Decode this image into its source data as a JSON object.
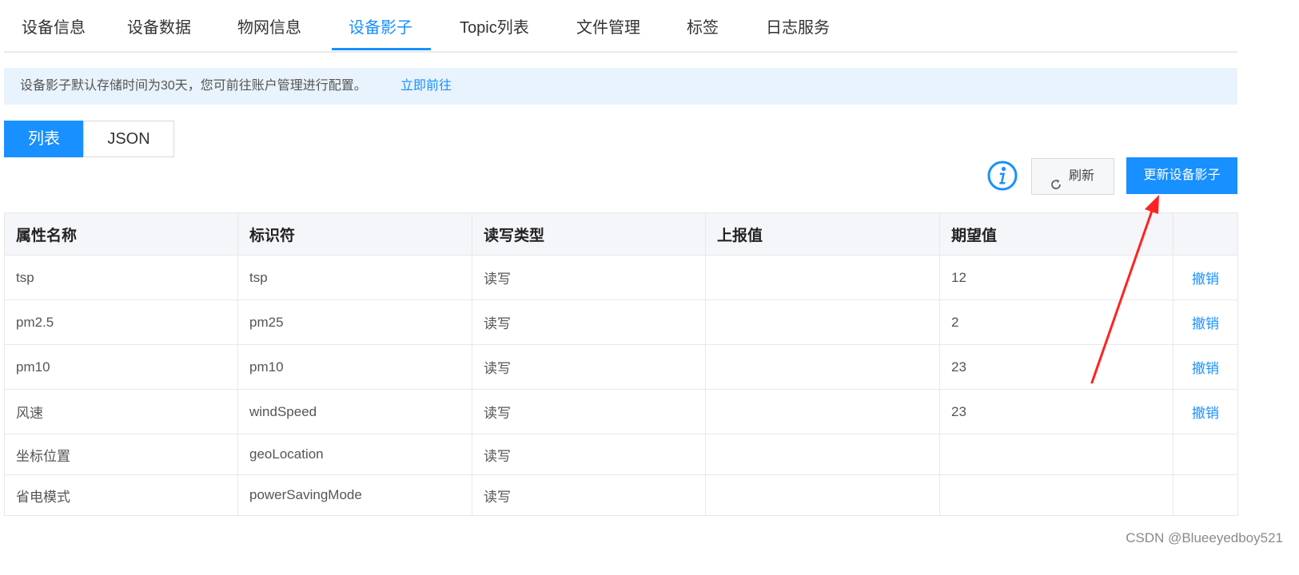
{
  "tabs": [
    {
      "label": "设备信息"
    },
    {
      "label": "设备数据"
    },
    {
      "label": "物网信息"
    },
    {
      "label": "设备影子",
      "active": true
    },
    {
      "label": "Topic列表"
    },
    {
      "label": "文件管理"
    },
    {
      "label": "标签"
    },
    {
      "label": "日志服务"
    }
  ],
  "alert": {
    "text": "设备影子默认存储时间为30天，您可前往账户管理进行配置。",
    "link": "立即前往"
  },
  "view_switch": {
    "list": "列表",
    "json": "JSON",
    "selected": "列表"
  },
  "toolbar": {
    "info_icon": "info-circle-icon",
    "refresh_icon": "refresh-icon",
    "refresh_label": "刷新",
    "update_label": "更新设备影子"
  },
  "table": {
    "columns": [
      "属性名称",
      "标识符",
      "读写类型",
      "上报值",
      "期望值",
      ""
    ],
    "rows": [
      {
        "name": "tsp",
        "identifier": "tsp",
        "rw": "读写",
        "reported": "",
        "desired": "12",
        "action": "撤销"
      },
      {
        "name": "pm2.5",
        "identifier": "pm25",
        "rw": "读写",
        "reported": "",
        "desired": "2",
        "action": "撤销"
      },
      {
        "name": "pm10",
        "identifier": "pm10",
        "rw": "读写",
        "reported": "",
        "desired": "23",
        "action": "撤销"
      },
      {
        "name": "风速",
        "identifier": "windSpeed",
        "rw": "读写",
        "reported": "",
        "desired": "23",
        "action": "撤销"
      },
      {
        "name": "坐标位置",
        "identifier": "geoLocation",
        "rw": "读写",
        "reported": "",
        "desired": "",
        "action": ""
      },
      {
        "name": "省电模式",
        "identifier": "powerSavingMode",
        "rw": "读写",
        "reported": "",
        "desired": "",
        "action": ""
      }
    ]
  },
  "colors": {
    "primary": "#1890ff",
    "alert_bg": "#e8f3fd",
    "annotation_arrow": "#ff2222"
  },
  "watermark": "CSDN @Blueeyedboy521"
}
